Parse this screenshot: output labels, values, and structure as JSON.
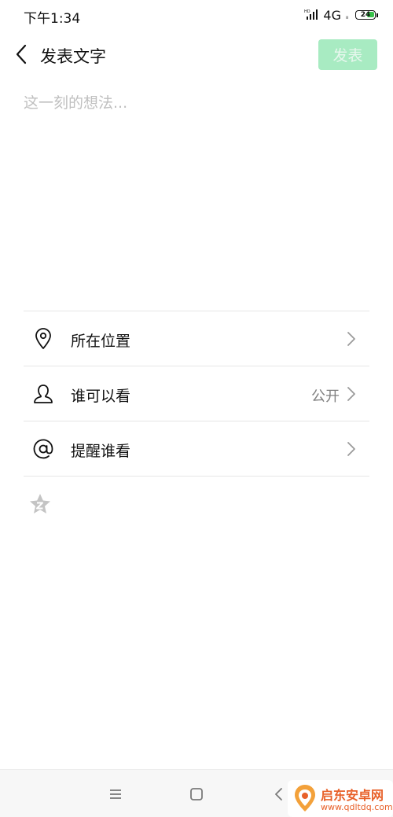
{
  "status_bar": {
    "time": "下午1:34",
    "network": "4G",
    "battery": "24"
  },
  "header": {
    "title": "发表文字",
    "publish_label": "发表"
  },
  "compose": {
    "placeholder": "这一刻的想法..."
  },
  "options": [
    {
      "label": "所在位置",
      "value": "",
      "icon": "location-icon"
    },
    {
      "label": "谁可以看",
      "value": "公开",
      "icon": "person-icon"
    },
    {
      "label": "提醒谁看",
      "value": "",
      "icon": "at-icon"
    }
  ],
  "extra_icon": "star-icon",
  "nav_bar": {
    "buttons": [
      "menu-icon",
      "home-icon",
      "back-icon"
    ]
  },
  "watermark": {
    "name": "启东安卓网",
    "url": "www.qdltdq.com"
  },
  "colors": {
    "accent": "#a8ebc2",
    "placeholder": "#bfbfbf",
    "divider": "#e6e6e6",
    "battery_fill": "#38c24a",
    "watermark": "#e8612a"
  }
}
